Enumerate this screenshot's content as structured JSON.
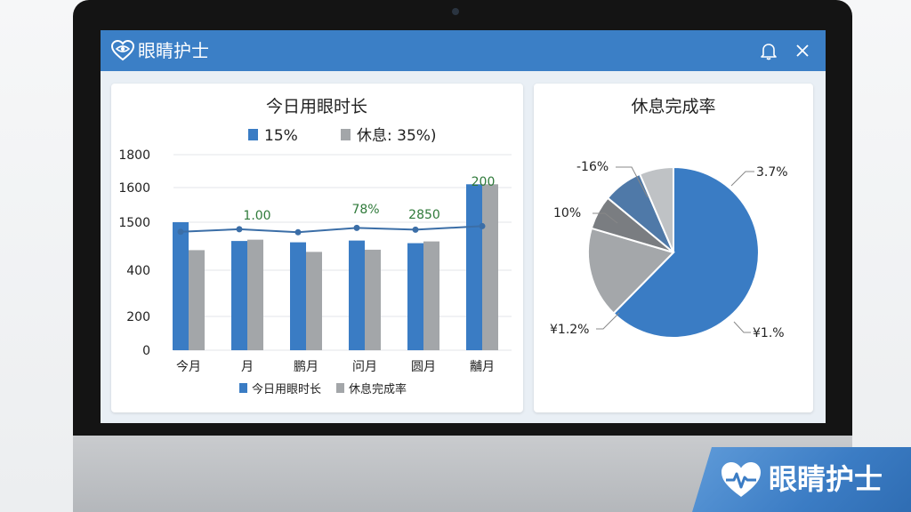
{
  "app": {
    "title": "眼睛护士"
  },
  "badge": {
    "text": "眼睛护士"
  },
  "icons": {
    "app_logo": "heart-eye-icon",
    "bell": "bell-icon",
    "close": "close-icon"
  },
  "colors": {
    "accent": "#3b7fc6",
    "bar_blue": "#3a7cc4",
    "bar_gray": "#a3a6a9",
    "line": "#3b6ea7"
  },
  "chart_data": [
    {
      "type": "bar",
      "title": "今日用眼时长",
      "top_legend": [
        {
          "color": "#3a7cc4",
          "label": "15%"
        },
        {
          "color": "#a3a6a9",
          "label": "休息:  35%)"
        }
      ],
      "yticks": [
        "1800",
        "1600",
        "1500",
        "400",
        "200",
        "0"
      ],
      "categories": [
        "今月",
        " 月",
        "鹏月",
        "问月",
        "圆月",
        "黼月"
      ],
      "series": [
        {
          "name": "今日用眼时长",
          "values": [
            1500,
            1070,
            1040,
            1080,
            1020,
            1620
          ]
        },
        {
          "name": "休息完成率",
          "values": [
            860,
            1100,
            820,
            870,
            1060,
            1620
          ]
        }
      ],
      "line_values": [
        1280,
        1340,
        1270,
        1370,
        1330,
        1410
      ],
      "annotations": [
        "1.00",
        "78%",
        "2850",
        "200"
      ],
      "legend": [
        "今日用眼时长",
        "休息完成率"
      ]
    },
    {
      "type": "pie",
      "title": "休息完成率",
      "slices": [
        {
          "label": "3.7%",
          "value": 58,
          "color": "#3a7cc4"
        },
        {
          "label": "¥1.2%",
          "value": 16,
          "color": "#a4a7aa"
        },
        {
          "label": "10%",
          "value": 6,
          "color": "#7a7d81"
        },
        {
          "label": "-16%",
          "value": 7,
          "color": "#4f79a8"
        },
        {
          "label": "",
          "value": 6,
          "color": "#bfc2c5"
        }
      ],
      "extra_label": "¥1.%"
    }
  ]
}
